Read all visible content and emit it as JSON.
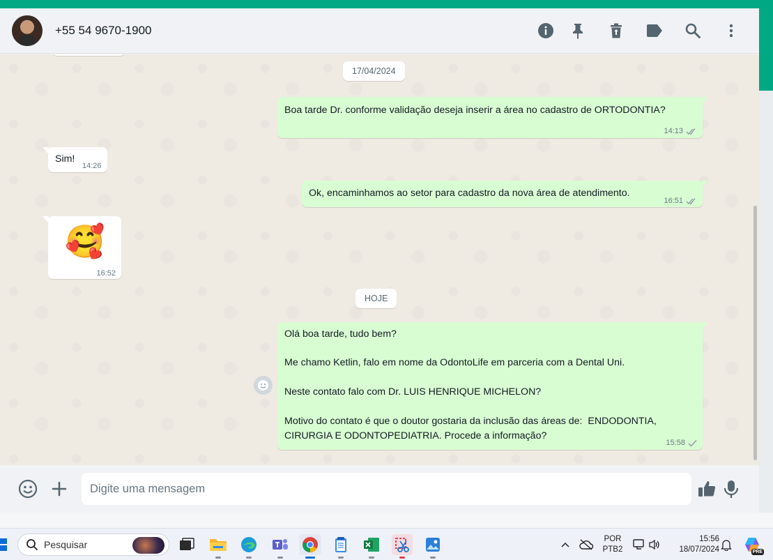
{
  "header": {
    "contact_name": "+55 54 9670-1900",
    "icons": [
      "info-icon",
      "pin-icon",
      "delete-icon",
      "label-icon",
      "search-icon",
      "menu-icon"
    ]
  },
  "chat": {
    "date_separator_1": "17/04/2024",
    "date_separator_2": "HOJE",
    "messages": [
      {
        "direction": "out",
        "text": "Boa tarde Dr. conforme validação deseja inserir a área no cadastro de ORTODONTIA?",
        "time": "14:13",
        "status": "read"
      },
      {
        "direction": "in",
        "text": "Sim!",
        "time": "14:26"
      },
      {
        "direction": "out",
        "text": "Ok, encaminhamos ao setor para cadastro da nova área de atendimento.",
        "time": "16:51",
        "status": "read"
      },
      {
        "direction": "in",
        "text": "🥰",
        "time": "16:52"
      },
      {
        "direction": "out",
        "lines": [
          "Olá boa tarde, tudo bem?",
          "Me chamo Ketlin, falo em nome da OdontoLife em parceria com a Dental Uni.",
          "Neste contato falo com Dr. LUIS HENRIQUE MICHELON?",
          "Motivo do contato é que o doutor gostaria da inclusão das áreas de:  ENDODONTIA,",
          "CIRURGIA E ODONTOPEDIATRIA. Procede a informação?"
        ],
        "time": "15:58",
        "status": "sent"
      }
    ]
  },
  "composer": {
    "placeholder": "Digite uma mensagem"
  },
  "taskbar": {
    "search_label": "Pesquisar",
    "lang_1": "POR",
    "lang_2": "PTB2",
    "time": "15:56",
    "date": "18/07/2024",
    "copilot_badge": "PRE"
  },
  "colors": {
    "accent": "#00a884",
    "outgoing_bubble": "#d9fdd3",
    "incoming_bubble": "#ffffff",
    "chat_bg": "#efeae2",
    "read_tick": "#8696a0"
  }
}
